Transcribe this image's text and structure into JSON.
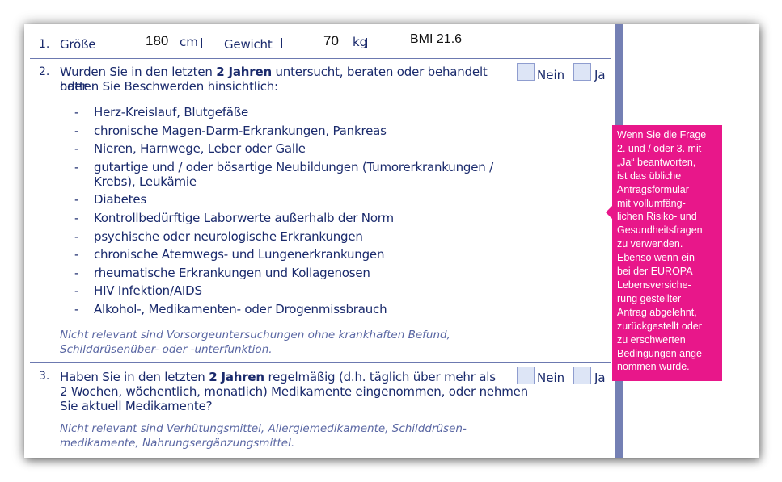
{
  "q1": {
    "number": "1.",
    "height_label": "Größe",
    "height_value": "180",
    "height_unit": "cm",
    "weight_label": "Gewicht",
    "weight_value": "70",
    "weight_unit": "kg",
    "bmi": "BMI 21.6"
  },
  "q2": {
    "number": "2.",
    "text_before": "Wurden Sie in den letzten ",
    "text_bold": "2 Jahren",
    "text_after": " untersucht, beraten oder behandelt oder",
    "text_line2": "hatten Sie Beschwerden hinsichtlich:",
    "no_label": "Nein",
    "yes_label": "Ja",
    "items": [
      "Herz-Kreislauf, Blutgefäße",
      "chronische Magen-Darm-Erkrankungen, Pankreas",
      "Nieren, Harnwege, Leber oder Galle",
      "gutartige und / oder bösartige Neubildungen (Tumorerkrankungen / Krebs), Leukämie",
      "Diabetes",
      "Kontrollbedürftige Laborwerte außerhalb der Norm",
      "psychische oder neurologische Erkrankungen",
      "chronische Atemwegs- und Lungenerkrankungen",
      "rheumatische Erkrankungen und Kollagenosen",
      "HIV Infektion/AIDS",
      "Alkohol-, Medikamenten- oder Drogenmissbrauch"
    ],
    "note_line1": "Nicht relevant sind Vorsorgeuntersuchungen ohne krankhaften Befund,",
    "note_line2": "Schilddrüsenüber- oder -unterfunktion."
  },
  "q3": {
    "number": "3.",
    "text_before": "Haben Sie in den letzten ",
    "text_bold": "2 Jahren",
    "text_after": " regelmäßig (d.h. täglich über mehr als",
    "text_line2": "2 Wochen, wöchentlich, monatlich) Medikamente eingenommen, oder nehmen",
    "text_line3": "Sie aktuell Medikamente?",
    "no_label": "Nein",
    "yes_label": "Ja",
    "note_line1": "Nicht relevant sind Verhütungsmittel, Allergiemedikamente, Schilddrüsen-",
    "note_line2": "medikamente, Nahrungsergänzungsmittel."
  },
  "sidenote": {
    "lines": [
      "Wenn Sie die Frage",
      "2. und / oder 3. mit",
      "„Ja“ beantworten,",
      "ist das übliche",
      "Antragsformular",
      "mit vollumfäng-",
      "lichen Risiko- und",
      "Gesundheitsfragen",
      "zu verwenden.",
      "Ebenso wenn ein",
      "bei der EUROPA",
      "Lebensversiche-",
      "rung gestellter",
      "Antrag abgelehnt,",
      "zurückgestellt oder",
      "zu erschwerten",
      "Bedingungen ange-",
      "nommen wurde."
    ],
    "color": "#e8178a"
  },
  "colors": {
    "ink": "#1a2a6c",
    "accent_bar": "#7480b4",
    "checkbox_fill": "#dde5f6"
  }
}
